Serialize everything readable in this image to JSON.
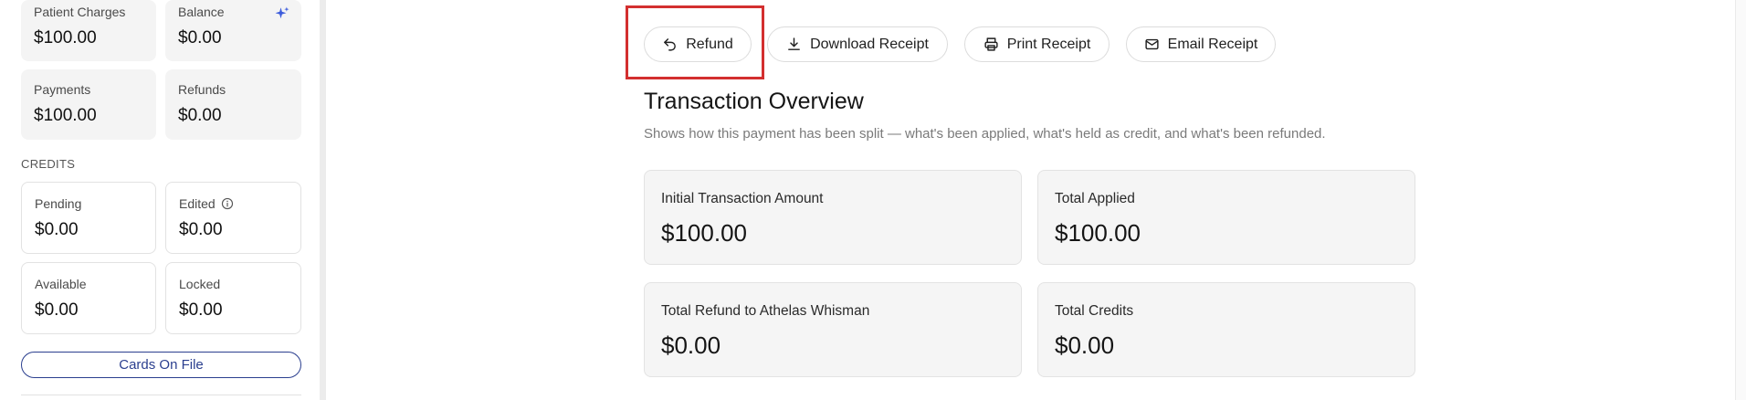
{
  "sidebar": {
    "summary": [
      {
        "label": "Patient Charges",
        "value": "$100.00"
      },
      {
        "label": "Balance",
        "value": "$0.00",
        "icon": "sparkle-icon"
      },
      {
        "label": "Payments",
        "value": "$100.00"
      },
      {
        "label": "Refunds",
        "value": "$0.00"
      }
    ],
    "credits_heading": "CREDITS",
    "credits": [
      {
        "label": "Pending",
        "value": "$0.00"
      },
      {
        "label": "Edited",
        "value": "$0.00",
        "icon": "info-icon"
      },
      {
        "label": "Available",
        "value": "$0.00"
      },
      {
        "label": "Locked",
        "value": "$0.00"
      }
    ],
    "cards_button": "Cards On File"
  },
  "actions": [
    {
      "label": "Refund",
      "icon": "undo-icon"
    },
    {
      "label": "Download Receipt",
      "icon": "download-icon"
    },
    {
      "label": "Print Receipt",
      "icon": "printer-icon"
    },
    {
      "label": "Email Receipt",
      "icon": "mail-icon"
    }
  ],
  "overview": {
    "title": "Transaction Overview",
    "subtitle": "Shows how this payment has been split — what's been applied, what's held as credit, and what's been refunded.",
    "cards": [
      {
        "label": "Initial Transaction Amount",
        "value": "$100.00"
      },
      {
        "label": "Total Applied",
        "value": "$100.00"
      },
      {
        "label": "Total Refund to Athelas Whisman",
        "value": "$0.00"
      },
      {
        "label": "Total Credits",
        "value": "$0.00"
      }
    ]
  },
  "colors": {
    "accent": "#2b3f8f",
    "highlight": "#d32f2f",
    "sparkle": "#3b5bdb"
  }
}
